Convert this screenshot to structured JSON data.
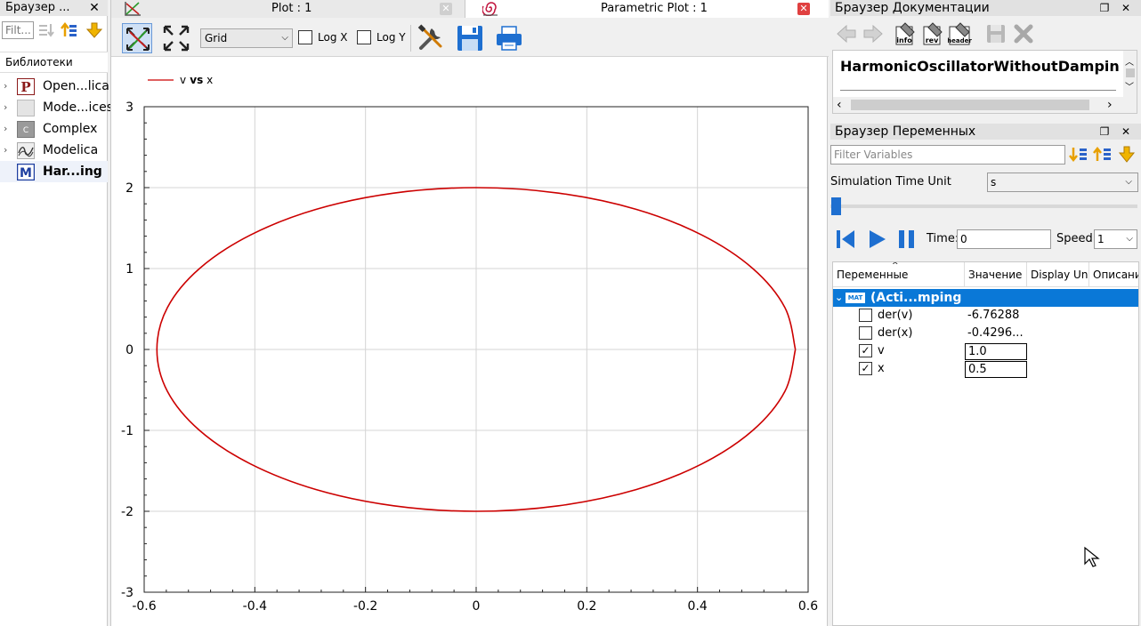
{
  "library_browser": {
    "title": "Браузер ...",
    "filter_placeholder": "Filt...",
    "header": "Библиотеки",
    "items": [
      {
        "label": "Open...lica",
        "icon": "openmodelica-p-icon"
      },
      {
        "label": "Mode...ices",
        "icon": "blank-library-icon"
      },
      {
        "label": "Complex",
        "icon": "complex-c-icon"
      },
      {
        "label": "Modelica",
        "icon": "modelica-library-icon"
      },
      {
        "label": "Har...ing",
        "icon": "model-m-icon"
      }
    ]
  },
  "tabs": [
    {
      "label": "Plot : 1"
    },
    {
      "label": "Parametric Plot : 1"
    }
  ],
  "toolbar": {
    "grid_option": "Grid",
    "log_x": "Log X",
    "log_y": "Log Y"
  },
  "chart_data": {
    "type": "line",
    "legend": "v vs x",
    "legend_placement": "top-left",
    "grid": true,
    "xlim": [
      -0.6,
      0.6
    ],
    "ylim": [
      -3,
      3
    ],
    "x_ticks": [
      "-0.6",
      "-0.4",
      "-0.2",
      "0",
      "0.2",
      "0.4",
      "0.6"
    ],
    "y_ticks": [
      "3",
      "2",
      "1",
      "0",
      "-1",
      "-2",
      "-3"
    ],
    "series": [
      {
        "name": "v vs x",
        "color": "#cc0000",
        "x": [
          0.577,
          0.558,
          0.5,
          0.408,
          0.289,
          0.149,
          0.0,
          -0.149,
          -0.289,
          -0.408,
          -0.5,
          -0.558,
          -0.577,
          -0.558,
          -0.5,
          -0.408,
          -0.289,
          -0.149,
          0.0,
          0.149,
          0.289,
          0.408,
          0.5,
          0.558,
          0.577
        ],
        "y": [
          0.0,
          0.518,
          1.0,
          1.414,
          1.732,
          1.932,
          2.0,
          1.932,
          1.732,
          1.414,
          1.0,
          0.518,
          0.0,
          -0.518,
          -1.0,
          -1.414,
          -1.732,
          -1.932,
          -2.0,
          -1.932,
          -1.732,
          -1.414,
          -1.0,
          -0.518,
          0.0
        ]
      }
    ]
  },
  "doc_browser": {
    "title": "Браузер Документации",
    "heading": "HarmonicOscillatorWithoutDampin"
  },
  "var_browser": {
    "title": "Браузер Переменных",
    "filter_placeholder": "Filter Variables",
    "sim_time_unit_label": "Simulation Time Unit",
    "sim_time_unit_value": "s",
    "time_label": "Time:",
    "time_value": "0",
    "speed_label": "Speed:",
    "speed_value": "1",
    "columns": [
      "Переменные",
      "Значение",
      "Display Un",
      "Описани"
    ],
    "group_label": "(Acti...mping",
    "group_badge": "MAT",
    "rows": [
      {
        "name": "der(v)",
        "value": "-6.76288",
        "checked": false,
        "editable": false
      },
      {
        "name": "der(x)",
        "value": "-0.4296...",
        "checked": false,
        "editable": false
      },
      {
        "name": "v",
        "value": "1.0",
        "checked": true,
        "editable": true
      },
      {
        "name": "x",
        "value": "0.5",
        "checked": true,
        "editable": true
      }
    ]
  }
}
